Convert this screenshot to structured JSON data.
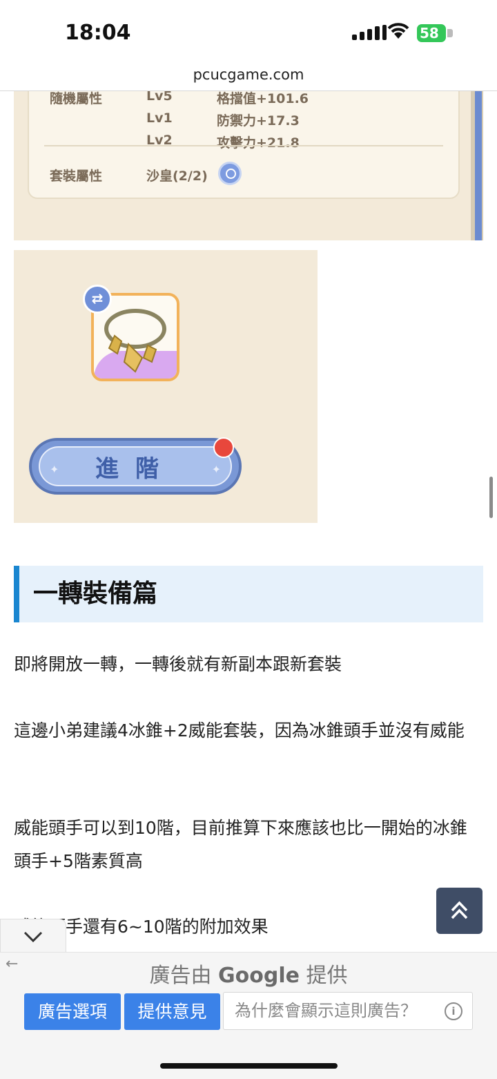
{
  "status_bar": {
    "time": "18:04",
    "battery": "58"
  },
  "browser": {
    "url": "pcucgame.com"
  },
  "game_screenshot_top": {
    "rows": [
      {
        "label": "隨機屬性",
        "level": "Lv5",
        "stat": "格擋值+101.6"
      },
      {
        "label": "",
        "level": "Lv1",
        "stat": "防禦力+17.3"
      },
      {
        "label": "",
        "level": "Lv2",
        "stat": "攻擊力+21.8"
      }
    ],
    "set_label": "套裝屬性",
    "set_value": "沙皇(2/2)"
  },
  "game_screenshot_bottom": {
    "advance_button": "進階"
  },
  "article": {
    "heading": "一轉裝備篇",
    "paragraphs": [
      "即將開放一轉，一轉後就有新副本跟新套裝",
      "這邊小弟建議4冰錐+2威能套裝，因為冰錐頭手並沒有威能",
      "威能頭手可以到10階，目前推算下來應該也比一開始的冰錐頭手+5階素質高",
      "威能頭手還有6~10階的附加效果"
    ]
  },
  "ad": {
    "title_prefix": "廣告由",
    "title_brand": "Google",
    "title_suffix": "提供",
    "options_button": "廣告選項",
    "feedback_button": "提供意見",
    "why_text": "為什麼會顯示這則廣告？"
  },
  "colors": {
    "accent_blue": "#1a86d0",
    "ad_button": "#3b82e8",
    "battery_green": "#34c759"
  }
}
